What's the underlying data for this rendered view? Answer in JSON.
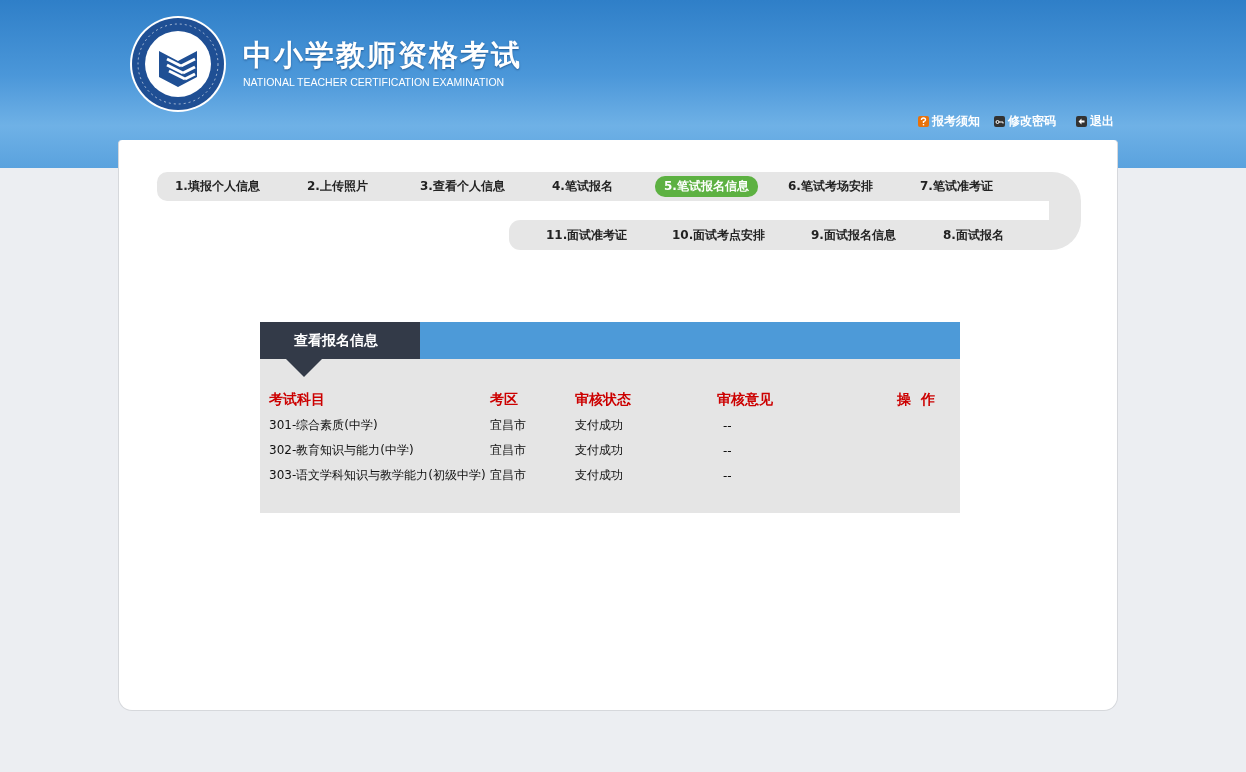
{
  "header": {
    "title": "中小学教师资格考试",
    "subtitle": "NATIONAL TEACHER CERTIFICATION EXAMINATION",
    "links": [
      {
        "label": "报考须知",
        "kind": "help"
      },
      {
        "label": "修改密码",
        "kind": "password"
      },
      {
        "label": "退出",
        "kind": "logout"
      }
    ]
  },
  "steps_row_1": [
    {
      "label": "1.填报个人信息",
      "selected": false
    },
    {
      "label": "2.上传照片",
      "selected": false
    },
    {
      "label": "3.查看个人信息",
      "selected": false
    },
    {
      "label": "4.笔试报名",
      "selected": false
    },
    {
      "label": "5.笔试报名信息",
      "selected": true
    },
    {
      "label": "6.笔试考场安排",
      "selected": false
    },
    {
      "label": "7.笔试准考证",
      "selected": false
    }
  ],
  "steps_row_2": [
    {
      "label": "11.面试准考证",
      "selected": false
    },
    {
      "label": "10.面试考点安排",
      "selected": false
    },
    {
      "label": "9.面试报名信息",
      "selected": false
    },
    {
      "label": "8.面试报名",
      "selected": false
    }
  ],
  "panel": {
    "title": "查看报名信息",
    "table": {
      "columns": [
        "考试科目",
        "考区",
        "审核状态",
        "审核意见",
        "操  作"
      ],
      "rows": [
        [
          "301-综合素质(中学)",
          "宜昌市",
          "支付成功",
          "--"
        ],
        [
          "302-教育知识与能力(中学)",
          "宜昌市",
          "支付成功",
          "--"
        ],
        [
          "303-语文学科知识与教学能力(初级中学)",
          "宜昌市",
          "支付成功",
          "--"
        ]
      ]
    }
  }
}
